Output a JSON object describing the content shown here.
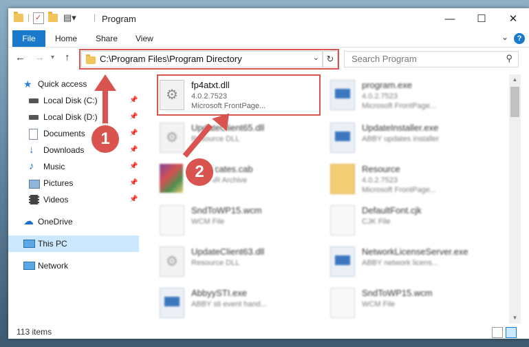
{
  "window": {
    "title": "Program",
    "controls": {
      "minimize": "—",
      "maximize": "☐",
      "close": "✕"
    }
  },
  "ribbon": {
    "tabs": [
      "File",
      "Home",
      "Share",
      "View"
    ],
    "help": "?"
  },
  "address": {
    "path": "C:\\Program Files\\Program Directory",
    "search_placeholder": "Search Program"
  },
  "sidebar": {
    "items": [
      {
        "label": "Quick access",
        "icon": "star-icon"
      },
      {
        "label": "Local Disk (C:)",
        "icon": "drive-icon"
      },
      {
        "label": "Local Disk (D:)",
        "icon": "drive-icon"
      },
      {
        "label": "Documents",
        "icon": "documents-icon"
      },
      {
        "label": "Downloads",
        "icon": "download-arrow-icon"
      },
      {
        "label": "Music",
        "icon": "music-note-icon"
      },
      {
        "label": "Pictures",
        "icon": "pictures-icon"
      },
      {
        "label": "Videos",
        "icon": "film-icon"
      },
      {
        "label": "OneDrive",
        "icon": "cloud-icon"
      },
      {
        "label": "This PC",
        "icon": "monitor-icon"
      },
      {
        "label": "Network",
        "icon": "network-icon"
      }
    ]
  },
  "files": [
    {
      "name": "fp4atxt.dll",
      "line2": "4.0.2.7523",
      "line3": "Microsoft FrontPage..."
    },
    {
      "name": "program.exe",
      "line2": "4.0.2.7523",
      "line3": "Microsoft FrontPage..."
    },
    {
      "name": "UpdateClient65.dll",
      "line2": "Resource DLL",
      "line3": ""
    },
    {
      "name": "UpdateInstaller.exe",
      "line2": "ABBY updates installer",
      "line3": ""
    },
    {
      "name": "Certificates.cab",
      "line2": "WinRAR Archive",
      "line3": ""
    },
    {
      "name": "Resource",
      "line2": "4.0.2.7523",
      "line3": "Microsoft FrontPage..."
    },
    {
      "name": "SndToWP15.wcm",
      "line2": "WCM File",
      "line3": ""
    },
    {
      "name": "DefaultFont.cjk",
      "line2": "CJK File",
      "line3": ""
    },
    {
      "name": "UpdateClient63.dll",
      "line2": "Resource DLL",
      "line3": ""
    },
    {
      "name": "NetworkLicenseServer.exe",
      "line2": "ABBY network licens...",
      "line3": ""
    },
    {
      "name": "AbbyySTI.exe",
      "line2": "ABBY sti event hand...",
      "line3": ""
    },
    {
      "name": "SndToWP15.wcm",
      "line2": "WCM File",
      "line3": ""
    }
  ],
  "status": {
    "count": "113 items"
  },
  "annotations": {
    "step1": "1",
    "step2": "2",
    "color": "#d9534f"
  }
}
